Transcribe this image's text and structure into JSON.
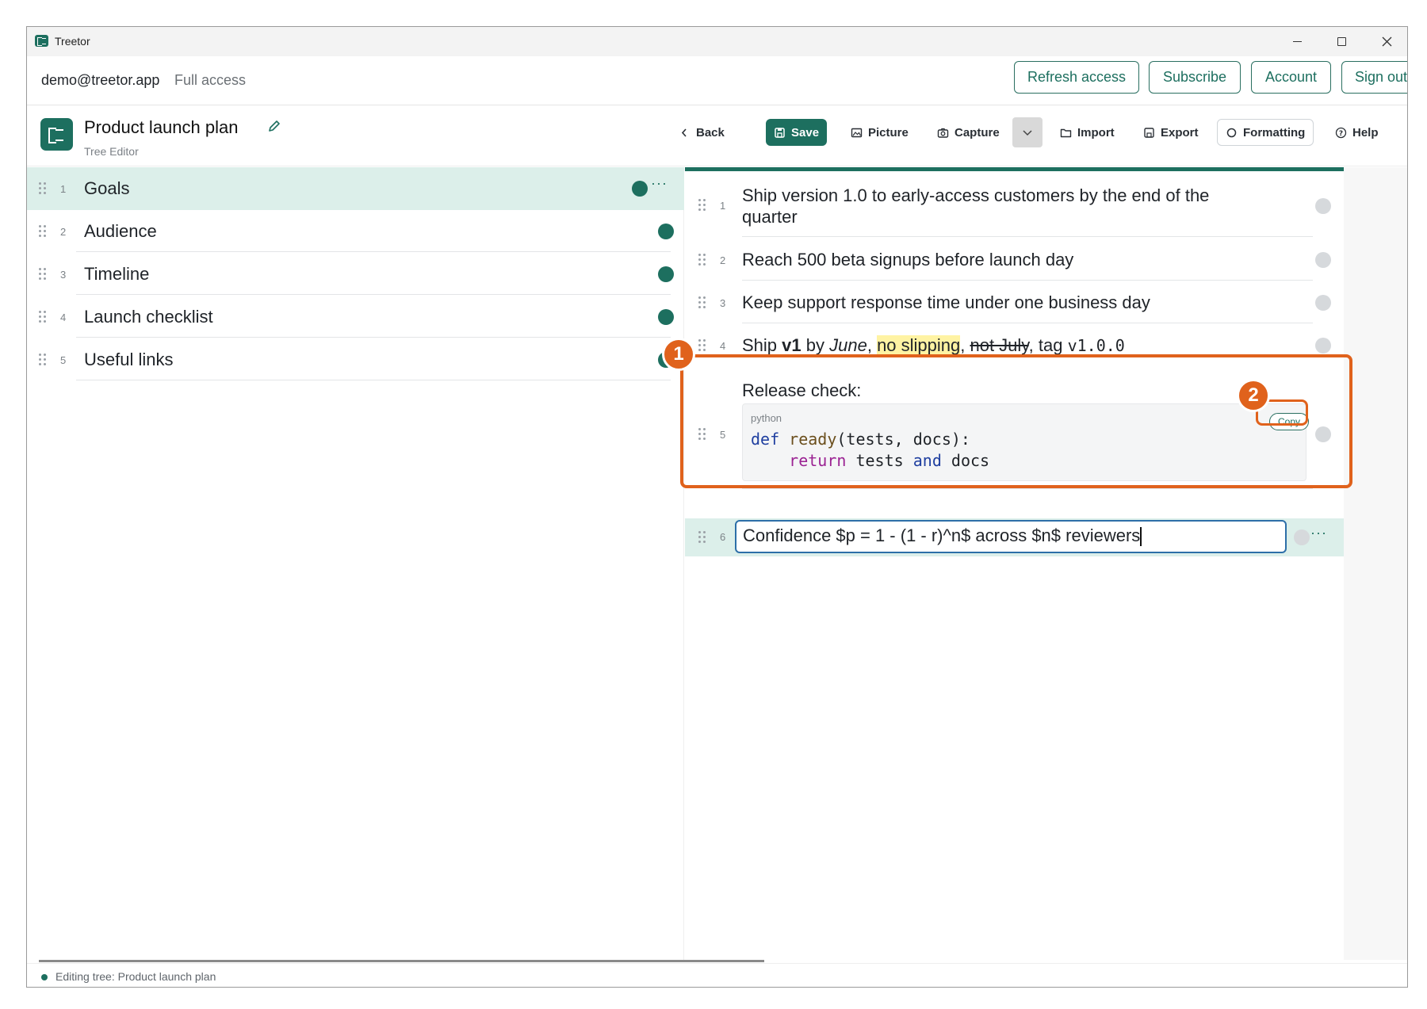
{
  "app": {
    "title": "Treetor"
  },
  "account": {
    "email": "demo@treetor.app",
    "access": "Full access",
    "buttons": [
      "Refresh access",
      "Subscribe",
      "Account",
      "Sign out"
    ]
  },
  "document": {
    "title": "Product launch plan",
    "subtitle": "Tree Editor"
  },
  "toolbar": {
    "back": "Back",
    "save": "Save",
    "picture": "Picture",
    "capture": "Capture",
    "import": "Import",
    "export": "Export",
    "formatting": "Formatting",
    "help": "Help"
  },
  "tree": [
    {
      "num": "1",
      "label": "Goals"
    },
    {
      "num": "2",
      "label": "Audience"
    },
    {
      "num": "3",
      "label": "Timeline"
    },
    {
      "num": "4",
      "label": "Launch checklist"
    },
    {
      "num": "5",
      "label": "Useful links"
    }
  ],
  "nodes": {
    "n1": {
      "num": "1",
      "line1": "Ship version 1.0 to early-access customers by the end of the",
      "line2": "quarter"
    },
    "n2": {
      "num": "2",
      "text": "Reach 500 beta signups before launch day"
    },
    "n3": {
      "num": "3",
      "text": "Keep support response time under one business day"
    },
    "n4": {
      "num": "4",
      "p1": "Ship ",
      "bold": "v1",
      "p2": " by ",
      "italic": "June",
      "p3": ", ",
      "highlight": "no slipping",
      "p4": ", ",
      "strike": "not July",
      "p5": ", tag ",
      "code": "v1.0.0"
    },
    "n5": {
      "num": "5",
      "label": "Release check:",
      "lang": "python",
      "copy": "Copy",
      "code_l1": {
        "kw": "def",
        "fn": "ready",
        "rest": "(tests, docs):"
      },
      "code_l2": {
        "kw": "return",
        "a": "tests",
        "and": "and",
        "b": "docs"
      }
    },
    "n6": {
      "num": "6",
      "text": "Confidence $p = 1 - (1 - r)^n$ across $n$ reviewers"
    }
  },
  "callouts": [
    "1",
    "2"
  ],
  "status": {
    "text": "Editing tree: Product launch plan"
  }
}
